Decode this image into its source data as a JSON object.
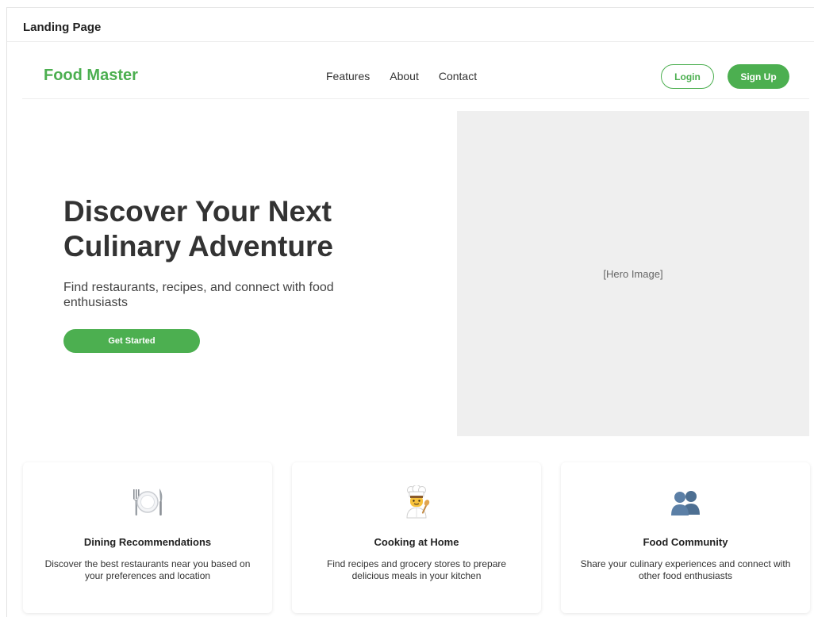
{
  "page_header": {
    "title": "Landing Page"
  },
  "navbar": {
    "brand": "Food Master",
    "links": [
      "Features",
      "About",
      "Contact"
    ],
    "login_label": "Login",
    "signup_label": "Sign Up"
  },
  "hero": {
    "title": "Discover Your Next Culinary Adventure",
    "subtitle": "Find restaurants, recipes, and connect with food enthusiasts",
    "cta_label": "Get Started",
    "image_placeholder": "[Hero Image]"
  },
  "features": [
    {
      "icon": "plate-cutlery-icon",
      "title": "Dining Recommendations",
      "description": "Discover the best restaurants near you based on your preferences and location"
    },
    {
      "icon": "chef-icon",
      "title": "Cooking at Home",
      "description": "Find recipes and grocery stores to prepare delicious meals in your kitchen"
    },
    {
      "icon": "community-icon",
      "title": "Food Community",
      "description": "Share your culinary experiences and connect with other food enthusiasts"
    }
  ],
  "colors": {
    "accent": "#4caf50",
    "hero_image_bg": "#efefef",
    "text_dark": "#333333"
  }
}
